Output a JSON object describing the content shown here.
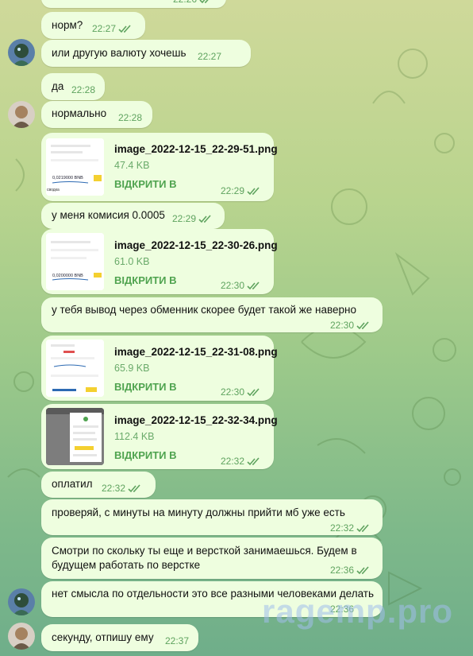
{
  "colors": {
    "bubble": "#eefedf",
    "accent": "#4fa34f",
    "time": "#5fa35f"
  },
  "messages": [
    {
      "id": "m0",
      "text": "",
      "time": "22:26"
    },
    {
      "id": "m1",
      "text": "норм?",
      "time": "22:27"
    },
    {
      "id": "m2",
      "text": "или другую валюту хочешь",
      "time": "22:27"
    },
    {
      "id": "m3",
      "text": "да",
      "time": "22:28"
    },
    {
      "id": "m4",
      "text": "нормально",
      "time": "22:28"
    },
    {
      "id": "f1",
      "file": "image_2022-12-15_22-29-51.png",
      "size": "47.4 KB",
      "open": "ВІДКРИТИ В",
      "time": "22:29"
    },
    {
      "id": "m5",
      "text": "у меня комисия 0.0005",
      "time": "22:29"
    },
    {
      "id": "f2",
      "file": "image_2022-12-15_22-30-26.png",
      "size": "61.0 KB",
      "open": "ВІДКРИТИ В",
      "time": "22:30"
    },
    {
      "id": "m6",
      "text": "у тебя вывод через обменник скорее будет такой же наверно",
      "time": "22:30"
    },
    {
      "id": "f3",
      "file": "image_2022-12-15_22-31-08.png",
      "size": "65.9 KB",
      "open": "ВІДКРИТИ В",
      "time": "22:30"
    },
    {
      "id": "f4",
      "file": "image_2022-12-15_22-32-34.png",
      "size": "112.4 KB",
      "open": "ВІДКРИТИ В",
      "time": "22:32"
    },
    {
      "id": "m7",
      "text": "оплатил",
      "time": "22:32"
    },
    {
      "id": "m8",
      "text": "проверяй, с минуты на минуту должны прийти мб уже есть",
      "time": "22:32"
    },
    {
      "id": "m9a",
      "text": "Смотри по скольку ты еще и версткой занимаешься. Будем в",
      "time": ""
    },
    {
      "id": "m9b",
      "text": "будущем работать по верстке",
      "time": "22:36"
    },
    {
      "id": "m10",
      "text": "нет смысла по отдельности это все разными человеками делать",
      "time": "22:36"
    },
    {
      "id": "m11",
      "text": "секунду, отпишу ему",
      "time": "22:37"
    }
  ],
  "thumbs": {
    "t1": "0,0219000 BNB",
    "t2": "0,0200000 BNB"
  },
  "watermark": "ragemp.pro"
}
